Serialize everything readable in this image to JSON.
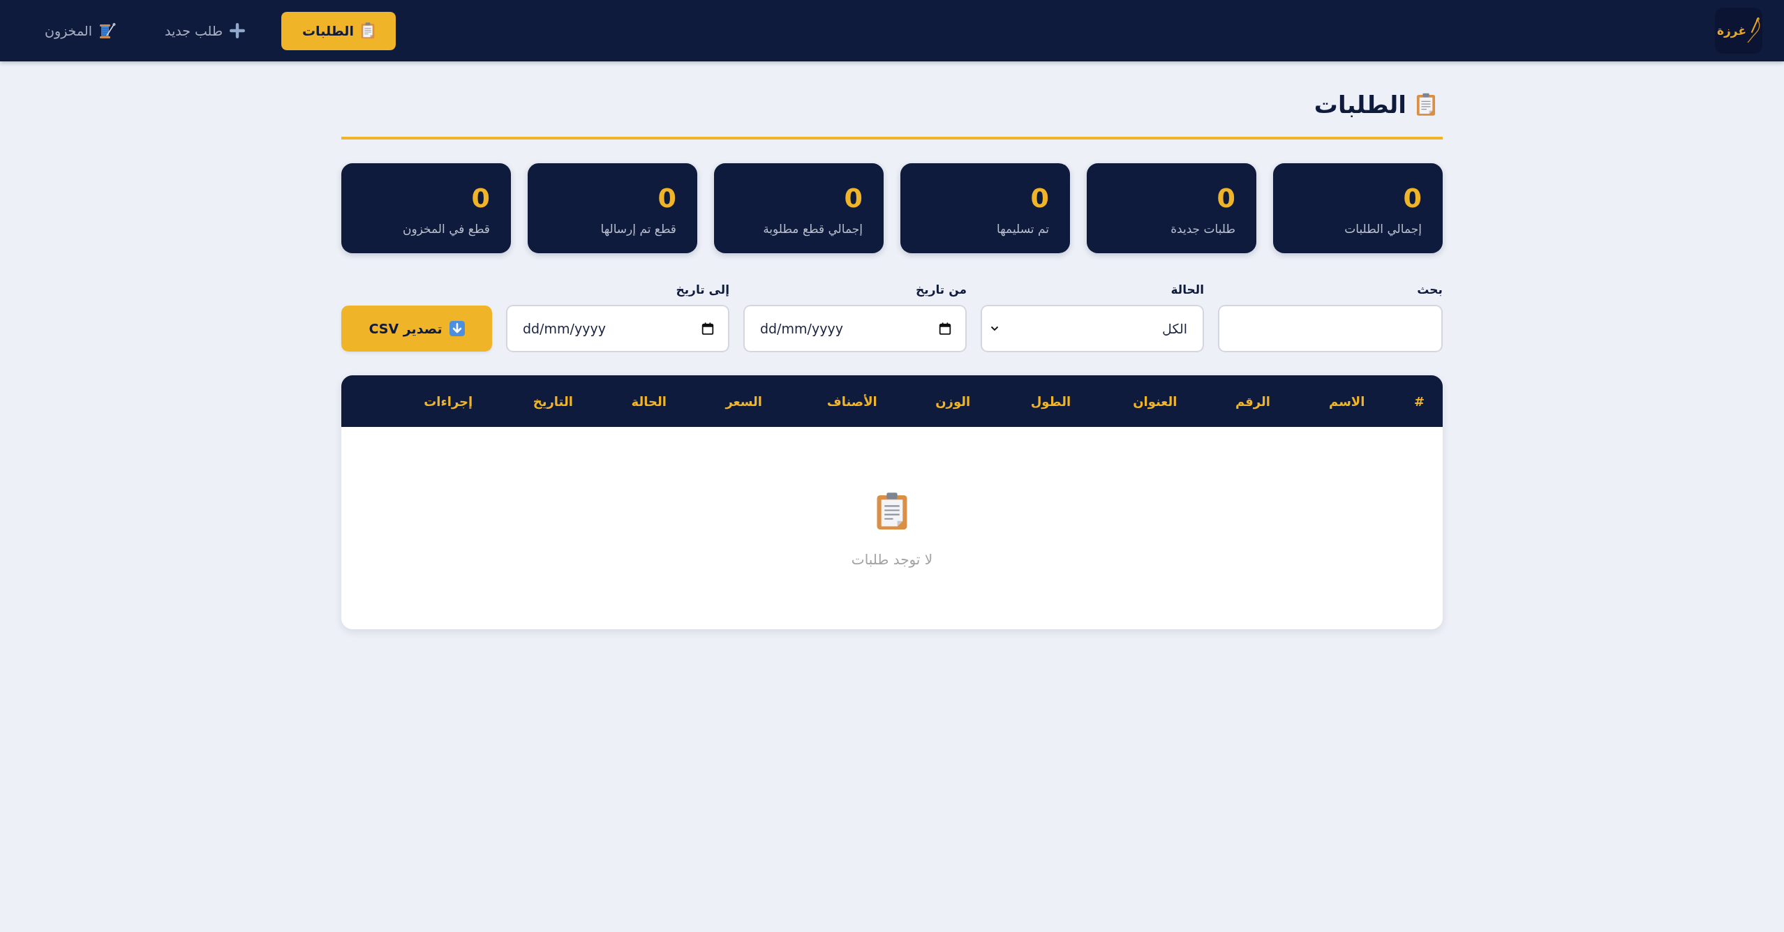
{
  "navbar": {
    "logo": {
      "text": "غرزة"
    },
    "items": [
      {
        "label": "الطلبات",
        "selected": true
      },
      {
        "label": "طلب جديد",
        "selected": false
      },
      {
        "label": "المخزون",
        "selected": false
      }
    ]
  },
  "page": {
    "title": "الطلبات"
  },
  "stats": [
    {
      "value": "0",
      "label": "إجمالي الطلبات"
    },
    {
      "value": "0",
      "label": "طلبات جديدة"
    },
    {
      "value": "0",
      "label": "تم تسليمها"
    },
    {
      "value": "0",
      "label": "إجمالي قطع مطلوبة"
    },
    {
      "value": "0",
      "label": "قطع تم إرسالها"
    },
    {
      "value": "0",
      "label": "قطع في المخزون"
    }
  ],
  "filters": {
    "search": {
      "label": "بحث"
    },
    "status": {
      "label": "الحالة",
      "value": "الكل"
    },
    "date_from": {
      "label": "من تاريخ",
      "placeholder": "dd/mm/yyyy"
    },
    "date_to": {
      "label": "إلى تاريخ",
      "placeholder": "dd/mm/yyyy"
    },
    "export_button": {
      "label": "تصدير CSV"
    }
  },
  "table": {
    "columns": [
      "#",
      "الاسم",
      "الرقم",
      "العنوان",
      "الطول",
      "الوزن",
      "الأصناف",
      "السعر",
      "الحالة",
      "التاريخ",
      "إجراءات"
    ],
    "empty_message": "لا توجد طلبات"
  }
}
